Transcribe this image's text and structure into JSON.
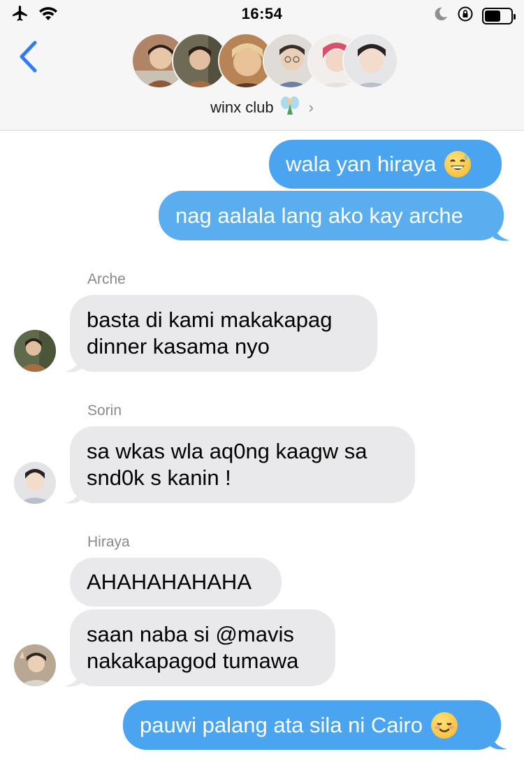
{
  "status_bar": {
    "time": "16:54",
    "left_icons": [
      "airplane-icon",
      "wifi-icon"
    ],
    "right_icons": [
      "moon-icon",
      "rotation-lock-icon",
      "battery-icon"
    ],
    "battery_level": 0.6
  },
  "header": {
    "group_name": "winx club",
    "group_emoji_icon": "fairy-icon",
    "avatars": [
      "member-avatar-1",
      "member-avatar-2",
      "member-avatar-3",
      "member-avatar-4",
      "member-avatar-5",
      "member-avatar-6"
    ]
  },
  "colors": {
    "outgoing_bubble": "#4aa4f0",
    "incoming_bubble": "#e9e9eb",
    "ios_blue": "#2f7cf6",
    "sender_gray": "#8a8a8e"
  },
  "messages": [
    {
      "direction": "out",
      "text": "wala yan hiraya",
      "emoji": "sweat-smile-emoji"
    },
    {
      "direction": "out",
      "text": "nag aalala lang ako kay arche"
    },
    {
      "direction": "in",
      "sender": "Arche",
      "lines": [
        "basta di kami makakapag",
        "dinner kasama nyo"
      ]
    },
    {
      "direction": "in",
      "sender": "Sorin",
      "lines": [
        "sa wkas wla aq0ng kaagw sa",
        "snd0k s kanin !"
      ]
    },
    {
      "direction": "in",
      "sender": "Hiraya",
      "text": "AHAHAHAHAHA"
    },
    {
      "direction": "in",
      "lines": [
        "saan naba si @mavis",
        "nakakapagod tumawa"
      ]
    },
    {
      "direction": "out",
      "text": "pauwi palang ata sila ni Cairo",
      "emoji": "relieved-smile-emoji"
    }
  ]
}
